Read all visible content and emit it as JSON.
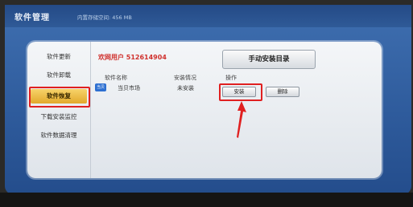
{
  "header": {
    "title": "软件管理",
    "storage": "内置存储空间: 456 MB"
  },
  "sidebar": {
    "items": [
      {
        "label": "软件更新",
        "active": false
      },
      {
        "label": "软件卸载",
        "active": false
      },
      {
        "label": "软件恢复",
        "active": true
      },
      {
        "label": "下载安装监控",
        "active": false
      },
      {
        "label": "软件数据清理",
        "active": false
      }
    ]
  },
  "main": {
    "user": "欢网用户 512614904",
    "manual_install_button": "手动安装目录",
    "columns": {
      "name": "软件名称",
      "status": "安装情况",
      "action": "操作"
    },
    "rows": [
      {
        "icon_text": "当贝",
        "name": "当贝市场",
        "status": "未安装",
        "install_label": "安装",
        "delete_label": "删除"
      }
    ]
  },
  "colors": {
    "screen_bg": "#2f5c9d",
    "highlight": "#e02020",
    "active_item": "#e2a92b",
    "user_text": "#d0312d"
  }
}
